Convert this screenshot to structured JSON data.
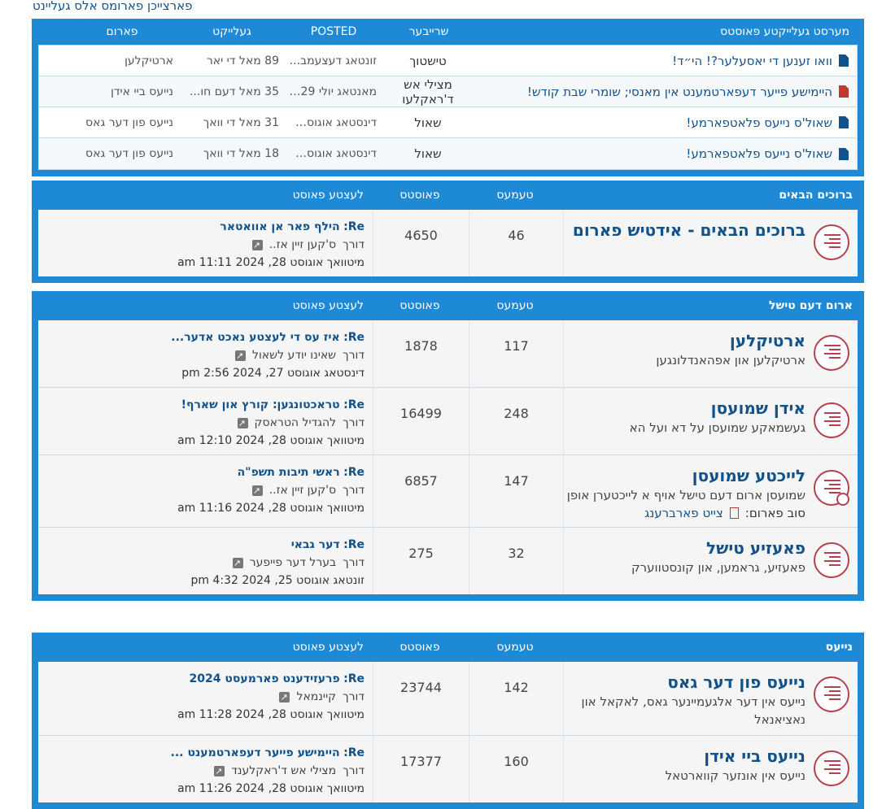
{
  "top_link": "פארצייכן פארומס אלס געליינט",
  "recent": {
    "headers": {
      "title": "מערסט געלייקטע פאוסטס",
      "writer": "שרייבער",
      "posted": "POSTED",
      "gallery": "געלייקט",
      "forum": "פארום"
    },
    "rows": [
      {
        "title": "וואו זענען די יאסעלער?! הי״ד!",
        "writer": "טישטוך",
        "posted": "זונטאג דעצעמב...",
        "likes": "89 מאל די יאר",
        "forum": "ארטיקלען",
        "icon": "blue"
      },
      {
        "title": "היימישע פייער דעפארטמענט אין מאנסי; שומרי שבת קודש!",
        "writer": "מצילי אש ד'ראקלעו",
        "posted": "מאנטאג יולי 29,...",
        "likes": "35 מאל דעם חו...",
        "forum": "נייעס ביי אידן",
        "icon": "red"
      },
      {
        "title": "שאול'ס נייעס פלאטפארמע!",
        "writer": "שאול",
        "posted": "דינסטאג אוגוסט...",
        "likes": "31 מאל די וואך",
        "forum": "נייעס פון דער גאס",
        "icon": "blue"
      },
      {
        "title": "שאול'ס נייעס פלאטפארמע!",
        "writer": "שאול",
        "posted": "דינסטאג אוגוסט...",
        "likes": "18 מאל די וואך",
        "forum": "נייעס פון דער גאס",
        "icon": "blue"
      }
    ]
  },
  "cols": {
    "topics": "טעמעס",
    "posts": "פאוסטס",
    "last": "לעצטע פאוסט"
  },
  "re_prefix": "Re:",
  "by_prefix": "דורך",
  "sections": [
    {
      "title": "ברוכים הבאים",
      "forums": [
        {
          "name": "ברוכים הבאים - אידטיש פארום",
          "desc": "",
          "topics": "46",
          "posts": "4650",
          "last_title": "הילף פאר אן אוואטאר",
          "last_by": "ס'קען זיין אז..",
          "last_date": "מיטוואך אוגוסט 28, 2024 11:11 am"
        }
      ]
    },
    {
      "title": "ארום דעם טישל",
      "forums": [
        {
          "name": "ארטיקלען",
          "desc": "ארטיקלען און אפהאנדלונגען",
          "topics": "117",
          "posts": "1878",
          "last_title": "איז עס די לעצטע נאכט אדער...",
          "last_by": "שאינו יודע לשאול",
          "last_date": "דינסטאג אוגוסט 27, 2024 2:56 pm"
        },
        {
          "name": "אידן שמועסן",
          "desc": "געשמאקע שמועסן על דא ועל הא",
          "topics": "248",
          "posts": "16499",
          "last_title": "טראכטונגען: קורץ און שארף!",
          "last_by": "להגדיל הטראסק",
          "last_date": "מיטוואך אוגוסט 28, 2024 12:10 am"
        },
        {
          "name": "לייכטע שמועסן",
          "desc": "שמועסן ארום דעם טישל אויף א לייכטערן אופן",
          "topics": "147",
          "posts": "6857",
          "last_title": "ראשי תיבות תשפ\"ה",
          "last_by": "ס'קען זיין אז..",
          "last_date": "מיטוואך אוגוסט 28, 2024 11:16 am",
          "sub_label": "סוב פארום:",
          "sub_forum": "צייט פארברענג"
        },
        {
          "name": "פאעזיע טישל",
          "desc": "פאעזיע, גראמען, און קונסטווערק",
          "topics": "32",
          "posts": "275",
          "last_title": "דער גבאי",
          "last_by": "בערל דער פייפער",
          "last_date": "זונטאג אוגוסט 25, 2024 4:32 pm"
        }
      ]
    },
    {
      "title": "נייעס",
      "forums": [
        {
          "name": "נייעס פון דער גאס",
          "desc": "נייעס אין דער אלגעמיינער גאס, לאקאל און נאציאנאל",
          "topics": "142",
          "posts": "23744",
          "last_title": "פרעזידענט פארמעסט 2024",
          "last_by": "קיינמאל",
          "last_date": "מיטוואך אוגוסט 28, 2024 11:28 am"
        },
        {
          "name": "נייעס ביי אידן",
          "desc": "נייעס אין אונזער קווארטאל",
          "topics": "160",
          "posts": "17377",
          "last_title": "היימישע פייער דעפארטמענט ...",
          "last_by": "מצילי אש ד'ראקלענד",
          "last_date": "מיטוואך אוגוסט 28, 2024 11:26 am"
        }
      ]
    }
  ]
}
